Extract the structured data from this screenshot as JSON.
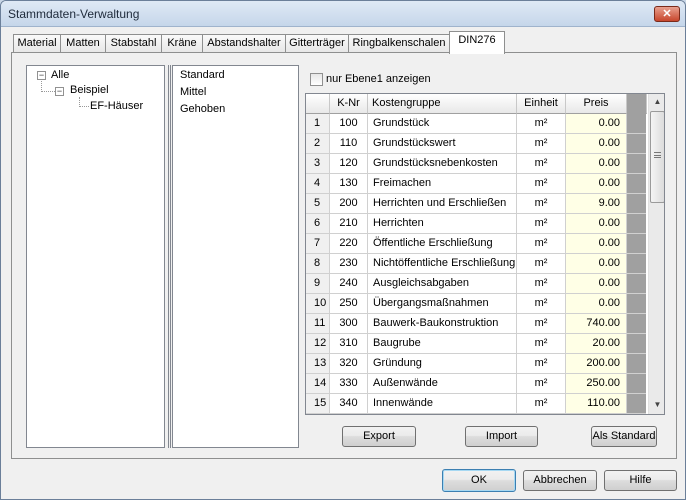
{
  "window": {
    "title": "Stammdaten-Verwaltung",
    "close_label": "✕"
  },
  "tabs": [
    "Material",
    "Matten",
    "Stabstahl",
    "Kräne",
    "Abstandshalter",
    "Gitterträger",
    "Ringbalkenschalen",
    "DIN276"
  ],
  "active_tab": "DIN276",
  "tree": {
    "root": {
      "label": "Alle",
      "toggle": "−"
    },
    "child": {
      "label": "Beispiel",
      "toggle": "−"
    },
    "leaf": {
      "label": "EF-Häuser"
    }
  },
  "levels": [
    "Standard",
    "Mittel",
    "Gehoben"
  ],
  "filter": {
    "checkbox_label": "nur Ebene1 anzeigen",
    "checked": false
  },
  "table": {
    "columns": {
      "nr": "",
      "knr": "K-Nr",
      "name": "Kostengruppe",
      "unit": "Einheit",
      "price": "Preis"
    },
    "rows": [
      {
        "nr": "1",
        "knr": "100",
        "name": "Grundstück",
        "unit": "m²",
        "price": "0.00"
      },
      {
        "nr": "2",
        "knr": "110",
        "name": "Grundstückswert",
        "unit": "m²",
        "price": "0.00"
      },
      {
        "nr": "3",
        "knr": "120",
        "name": "Grundstücksnebenkosten",
        "unit": "m²",
        "price": "0.00"
      },
      {
        "nr": "4",
        "knr": "130",
        "name": "Freimachen",
        "unit": "m²",
        "price": "0.00"
      },
      {
        "nr": "5",
        "knr": "200",
        "name": "Herrichten und Erschließen",
        "unit": "m²",
        "price": "9.00"
      },
      {
        "nr": "6",
        "knr": "210",
        "name": "Herrichten",
        "unit": "m²",
        "price": "0.00"
      },
      {
        "nr": "7",
        "knr": "220",
        "name": "Öffentliche Erschließung",
        "unit": "m²",
        "price": "0.00"
      },
      {
        "nr": "8",
        "knr": "230",
        "name": "Nichtöffentliche Erschließung",
        "unit": "m²",
        "price": "0.00"
      },
      {
        "nr": "9",
        "knr": "240",
        "name": "Ausgleichsabgaben",
        "unit": "m²",
        "price": "0.00"
      },
      {
        "nr": "10",
        "knr": "250",
        "name": "Übergangsmaßnahmen",
        "unit": "m²",
        "price": "0.00"
      },
      {
        "nr": "11",
        "knr": "300",
        "name": "Bauwerk-Baukonstruktion",
        "unit": "m²",
        "price": "740.00"
      },
      {
        "nr": "12",
        "knr": "310",
        "name": "Baugrube",
        "unit": "m²",
        "price": "20.00"
      },
      {
        "nr": "13",
        "knr": "320",
        "name": "Gründung",
        "unit": "m²",
        "price": "200.00"
      },
      {
        "nr": "14",
        "knr": "330",
        "name": "Außenwände",
        "unit": "m²",
        "price": "250.00"
      },
      {
        "nr": "15",
        "knr": "340",
        "name": "Innenwände",
        "unit": "m²",
        "price": "110.00"
      }
    ]
  },
  "scrollbar": {
    "up_arrow": "▲",
    "down_arrow": "▼"
  },
  "actions": {
    "export": "Export",
    "import": "Import",
    "as_standard": "Als Standard"
  },
  "footer": {
    "ok": "OK",
    "cancel": "Abbrechen",
    "help": "Hilfe"
  },
  "colors": {
    "price_cell_bg": "#ffffe6",
    "gray_column": "#a0a0a0"
  }
}
